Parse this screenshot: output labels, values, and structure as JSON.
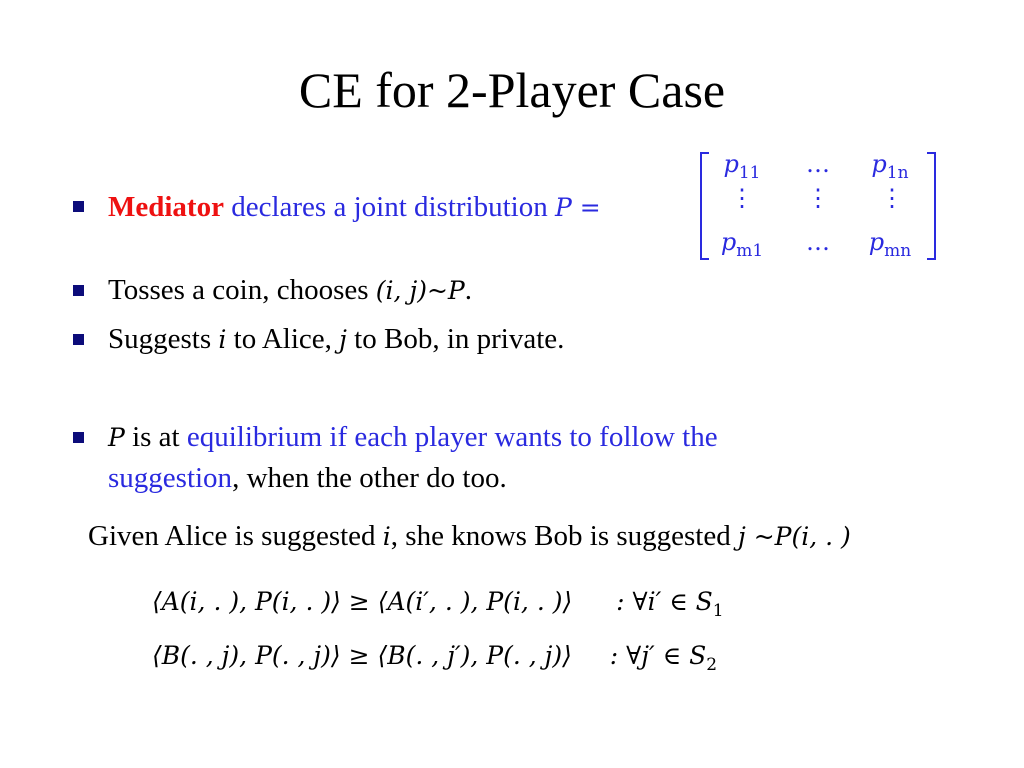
{
  "slide": {
    "title": "CE for 2-Player Case",
    "bullet1": {
      "highlight": "Mediator",
      "text": " declares a joint distribution ",
      "var": "P",
      "eq": " ="
    },
    "matrix": {
      "r1c1": "p",
      "r1c1_sub": "11",
      "r1c2": "…",
      "r1c3": "p",
      "r1c3_sub": "1n",
      "r2c1": "⋮",
      "r2c2": "⋮",
      "r2c3": "⋮",
      "r3c1": "p",
      "r3c1_sub": "m1",
      "r3c2": "…",
      "r3c3": "p",
      "r3c3_sub": "mn"
    },
    "bullet2": {
      "text": "Tosses a coin, chooses ",
      "math": "(i, j)~P",
      "end": "."
    },
    "bullet3": {
      "t1": "Suggests ",
      "i": "i",
      "t2": " to Alice, ",
      "j": "j",
      "t3": " to Bob, in private."
    },
    "bullet4": {
      "var": "P",
      "t1": " is at ",
      "blue1": "equilibrium if each player wants to follow the",
      "blue2": "suggestion",
      "t2": ", when the other do too."
    },
    "given": {
      "t1": "Given Alice is suggested  ",
      "i": "i",
      "t2": ", she knows Bob is suggested ",
      "math": "j ~P(i, . )"
    },
    "ineq1": {
      "lhs": "⟨A(i, . ), P(i, . )⟩ ≥ ⟨A(i′, . ), P(i, . )⟩",
      "cond": ": ∀i′ ∈ S",
      "sub": "1"
    },
    "ineq2": {
      "lhs": "⟨B(. , j), P(. , j)⟩ ≥ ⟨B(. , j′), P(. , j)⟩",
      "cond": ": ∀j′ ∈ S",
      "sub": "2"
    }
  }
}
